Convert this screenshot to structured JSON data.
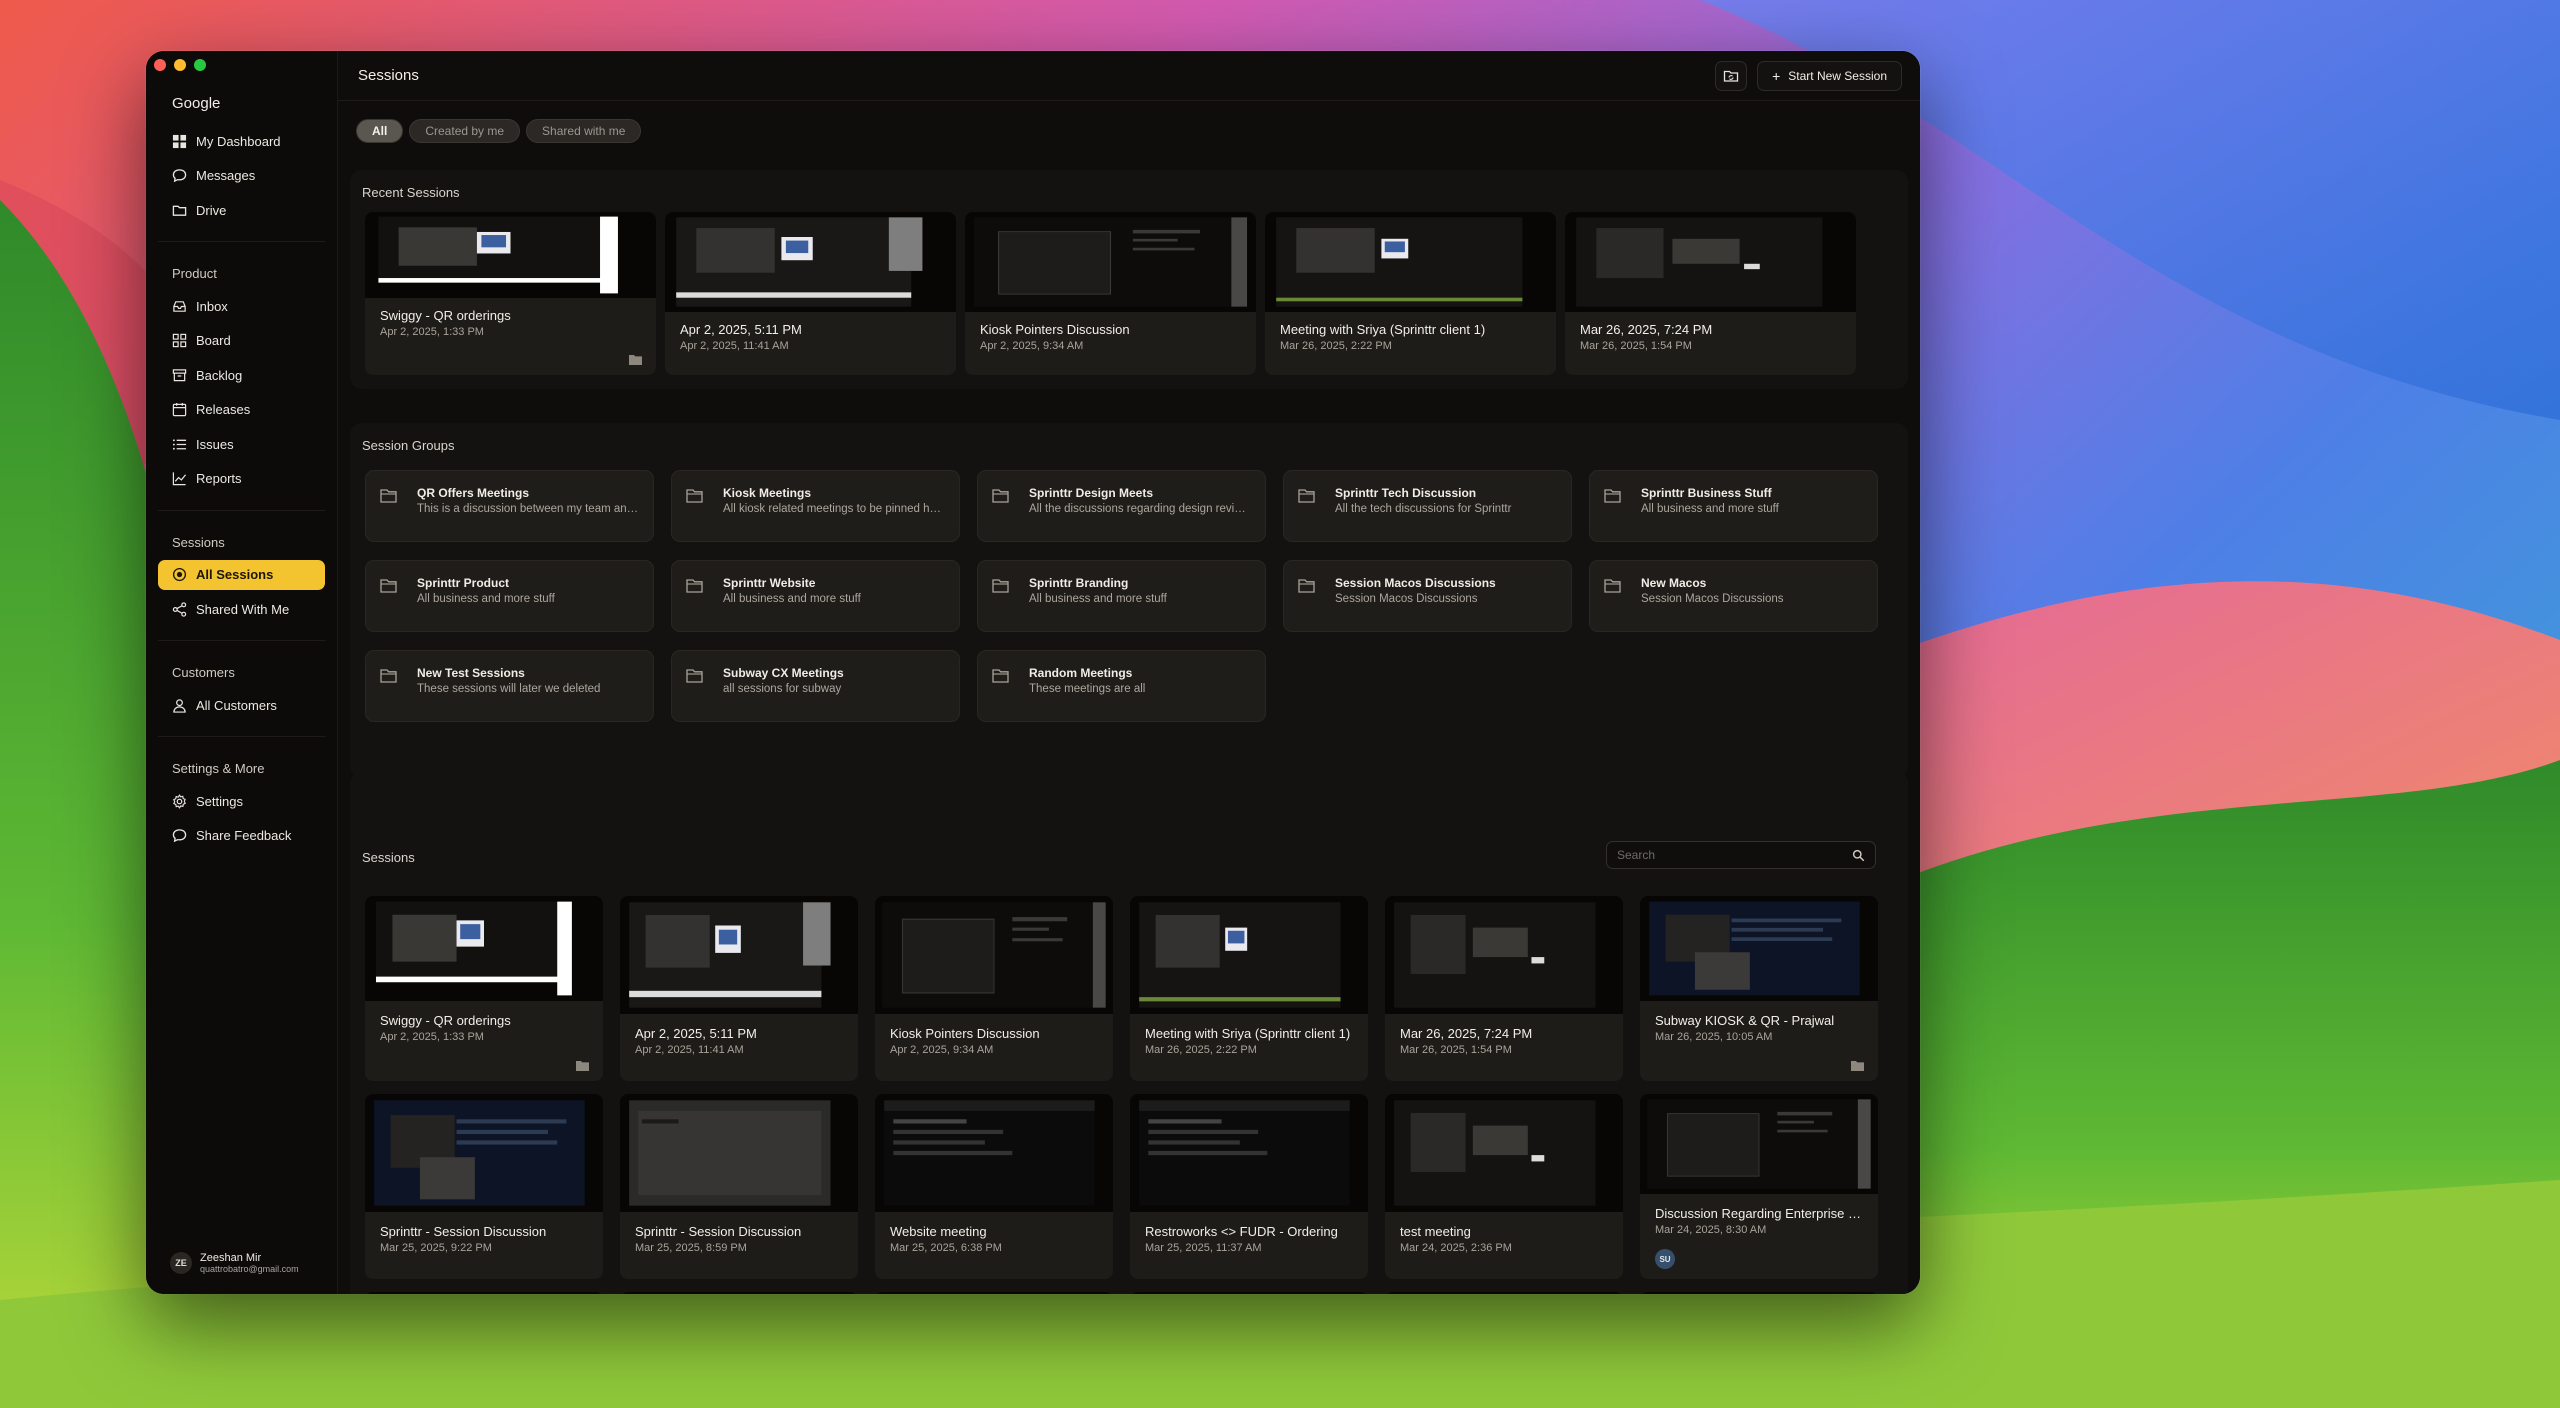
{
  "sidebar": {
    "brand": "Google",
    "top_items": [
      {
        "label": "My Dashboard",
        "icon": "dashboard-icon"
      },
      {
        "label": "Messages",
        "icon": "message-icon"
      },
      {
        "label": "Drive",
        "icon": "folder-icon"
      }
    ],
    "product": {
      "title": "Product",
      "items": [
        {
          "label": "Inbox",
          "icon": "inbox-icon"
        },
        {
          "label": "Board",
          "icon": "board-icon"
        },
        {
          "label": "Backlog",
          "icon": "archive-icon"
        },
        {
          "label": "Releases",
          "icon": "calendar-icon"
        },
        {
          "label": "Issues",
          "icon": "list-icon"
        },
        {
          "label": "Reports",
          "icon": "chart-icon"
        }
      ]
    },
    "sessions": {
      "title": "Sessions",
      "items": [
        {
          "label": "All Sessions",
          "icon": "record-icon",
          "active": true
        },
        {
          "label": "Shared With Me",
          "icon": "share-icon"
        }
      ]
    },
    "customers": {
      "title": "Customers",
      "items": [
        {
          "label": "All Customers",
          "icon": "user-icon"
        }
      ]
    },
    "settings": {
      "title": "Settings & More",
      "items": [
        {
          "label": "Settings",
          "icon": "gear-icon"
        },
        {
          "label": "Share Feedback",
          "icon": "message-icon"
        }
      ]
    },
    "user": {
      "initials": "ZE",
      "name": "Zeeshan Mir",
      "email": "quattrobatro@gmail.com"
    }
  },
  "header": {
    "title": "Sessions",
    "new_session_label": "Start New Session",
    "new_session_icon": "plus-icon",
    "folder_action_icon": "folder-sync-icon"
  },
  "filters": [
    "All",
    "Created by me",
    "Shared with me"
  ],
  "active_filter": "All",
  "recent": {
    "title": "Recent Sessions",
    "items": [
      {
        "title": "Swiggy - QR orderings",
        "date": "Apr 2, 2025, 1:33 PM",
        "in_folder": true
      },
      {
        "title": "Apr 2, 2025, 5:11 PM",
        "date": "Apr 2, 2025, 11:41 AM",
        "in_folder": false
      },
      {
        "title": "Kiosk Pointers Discussion",
        "date": "Apr 2, 2025, 9:34 AM",
        "in_folder": false
      },
      {
        "title": "Meeting with Sriya (Sprinttr client 1)",
        "date": "Mar 26, 2025, 2:22 PM",
        "in_folder": false
      },
      {
        "title": "Mar 26, 2025, 7:24 PM",
        "date": "Mar 26, 2025, 1:54 PM",
        "in_folder": false
      }
    ]
  },
  "groups": {
    "title": "Session Groups",
    "items": [
      {
        "name": "QR Offers Meetings",
        "desc": "This is a discussion between my team and the client"
      },
      {
        "name": "Kiosk Meetings",
        "desc": "All kiosk related meetings to be pinned here"
      },
      {
        "name": "Sprinttr Design Meets",
        "desc": "All the discussions regarding design reviews"
      },
      {
        "name": "Sprinttr Tech Discussion",
        "desc": "All the tech discussions for Sprinttr"
      },
      {
        "name": "Sprinttr Business Stuff",
        "desc": "All business and more stuff"
      },
      {
        "name": "Sprinttr Product",
        "desc": "All business and more stuff"
      },
      {
        "name": "Sprinttr Website",
        "desc": "All business and more stuff"
      },
      {
        "name": "Sprinttr Branding",
        "desc": "All business and more stuff"
      },
      {
        "name": "Session Macos Discussions",
        "desc": "Session Macos Discussions"
      },
      {
        "name": "New Macos",
        "desc": "Session Macos Discussions"
      },
      {
        "name": "New Test Sessions",
        "desc": "These sessions will later we deleted"
      },
      {
        "name": "Subway CX Meetings",
        "desc": "all sessions for subway"
      },
      {
        "name": "Random Meetings",
        "desc": "These meetings are all"
      }
    ]
  },
  "sessions": {
    "title": "Sessions",
    "search_placeholder": "Search",
    "items": [
      {
        "title": "Swiggy - QR orderings",
        "date": "Apr 2, 2025, 1:33 PM",
        "in_folder": true
      },
      {
        "title": "Apr 2, 2025, 5:11 PM",
        "date": "Apr 2, 2025, 11:41 AM"
      },
      {
        "title": "Kiosk Pointers Discussion",
        "date": "Apr 2, 2025, 9:34 AM"
      },
      {
        "title": "Meeting with Sriya (Sprinttr client 1)",
        "date": "Mar 26, 2025, 2:22 PM"
      },
      {
        "title": "Mar 26, 2025, 7:24 PM",
        "date": "Mar 26, 2025, 1:54 PM"
      },
      {
        "title": "Subway KIOSK & QR - Prajwal",
        "date": "Mar 26, 2025, 10:05 AM",
        "in_folder": true
      },
      {
        "title": "Sprinttr - Session Discussion",
        "date": "Mar 25, 2025, 9:22 PM"
      },
      {
        "title": "Sprinttr - Session Discussion",
        "date": "Mar 25, 2025, 8:59 PM"
      },
      {
        "title": "Website meeting",
        "date": "Mar 25, 2025, 6:38 PM"
      },
      {
        "title": "Restroworks <> FUDR - Ordering",
        "date": "Mar 25, 2025, 11:37 AM"
      },
      {
        "title": "test meeting",
        "date": "Mar 24, 2025, 2:36 PM"
      },
      {
        "title": "Discussion Regarding Enterprise Sales",
        "date": "Mar 24, 2025, 8:30 AM",
        "badge": "SU"
      }
    ]
  }
}
